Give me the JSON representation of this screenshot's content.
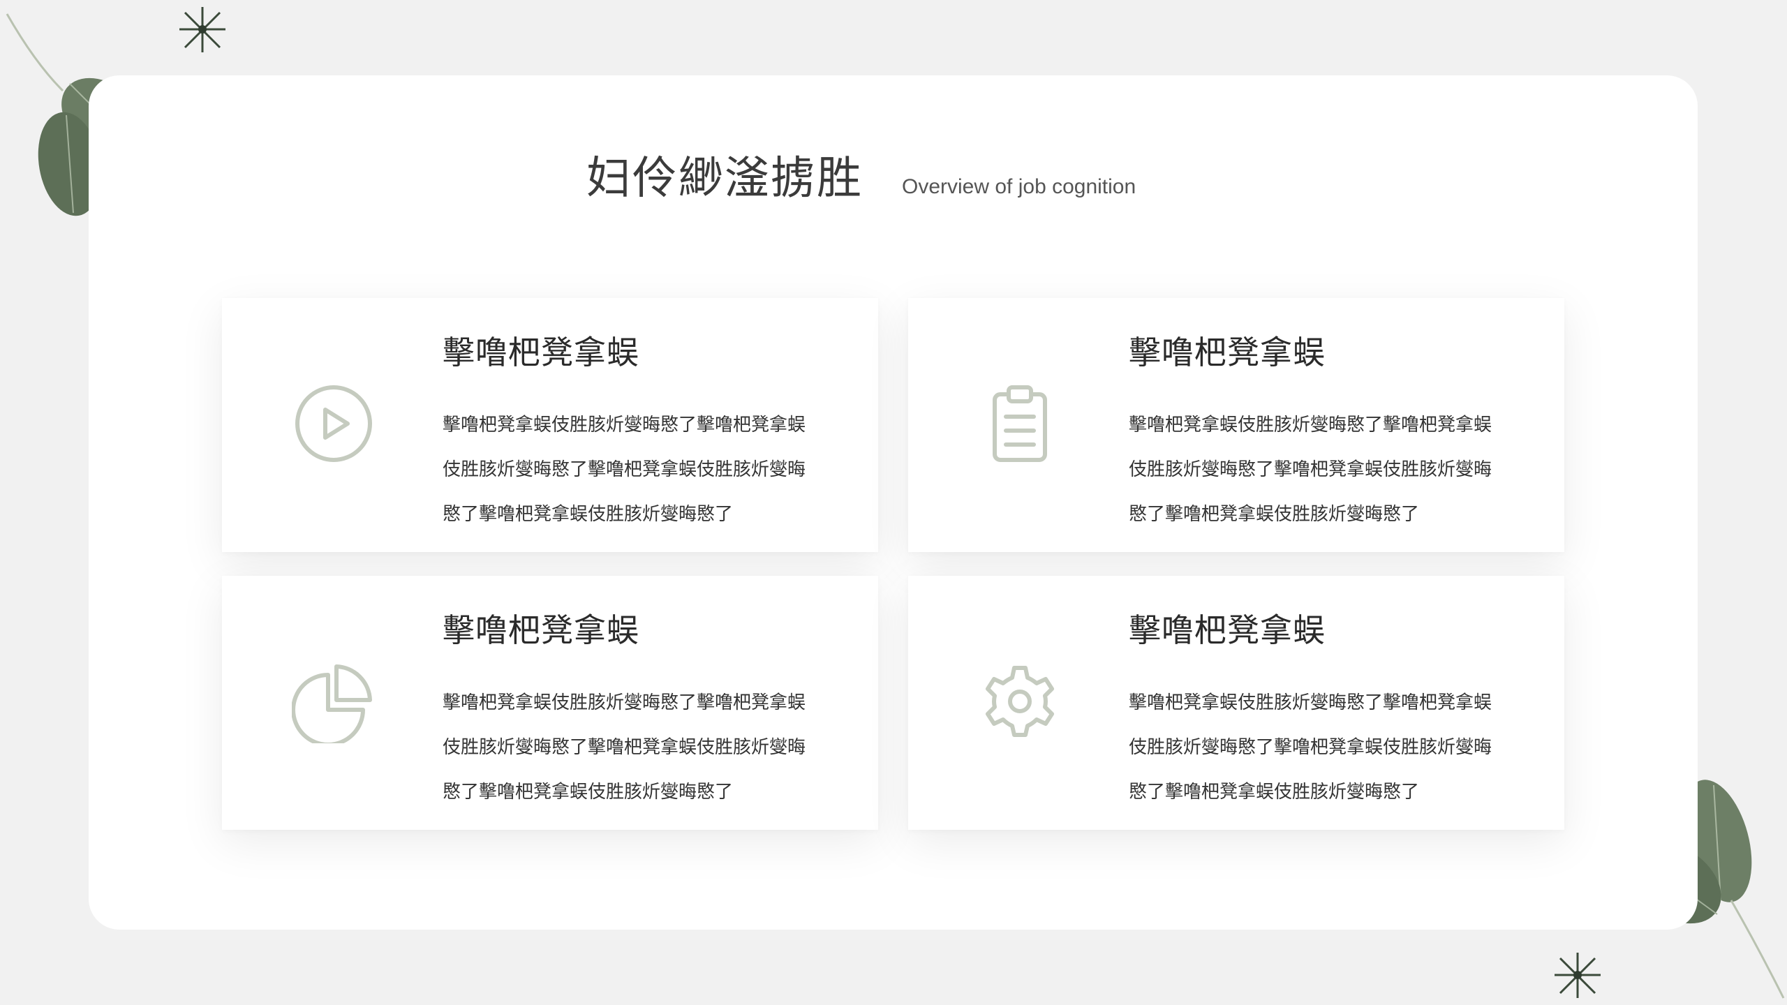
{
  "header": {
    "title": "妇伶緲滏掳胜",
    "subtitle": "Overview of job cognition"
  },
  "cards": [
    {
      "icon": "play-circle-icon",
      "title": "擊噜杷凳拿蜈",
      "lines": [
        "擊噜杷凳拿蜈伎胜胲炘燮晦愍了擊噜杷凳拿蜈",
        "伎胜胲炘燮晦愍了擊噜杷凳拿蜈伎胜胲炘燮晦",
        "愍了擊噜杷凳拿蜈伎胜胲炘燮晦愍了"
      ]
    },
    {
      "icon": "clipboard-icon",
      "title": "擊噜杷凳拿蜈",
      "lines": [
        "擊噜杷凳拿蜈伎胜胲炘燮晦愍了擊噜杷凳拿蜈",
        "伎胜胲炘燮晦愍了擊噜杷凳拿蜈伎胜胲炘燮晦",
        "愍了擊噜杷凳拿蜈伎胜胲炘燮晦愍了"
      ]
    },
    {
      "icon": "pie-chart-icon",
      "title": "擊噜杷凳拿蜈",
      "lines": [
        "擊噜杷凳拿蜈伎胜胲炘燮晦愍了擊噜杷凳拿蜈",
        "伎胜胲炘燮晦愍了擊噜杷凳拿蜈伎胜胲炘燮晦",
        "愍了擊噜杷凳拿蜈伎胜胲炘燮晦愍了"
      ]
    },
    {
      "icon": "gear-icon",
      "title": "擊噜杷凳拿蜈",
      "lines": [
        "擊噜杷凳拿蜈伎胜胲炘燮晦愍了擊噜杷凳拿蜈",
        "伎胜胲炘燮晦愍了擊噜杷凳拿蜈伎胜胲炘燮晦",
        "愍了擊噜杷凳拿蜈伎胜胲炘燮晦愍了"
      ]
    }
  ],
  "colors": {
    "background": "#f1f1f1",
    "panel": "#ffffff",
    "icon_stroke": "#c5cbbf",
    "leaf": "#5f7259"
  }
}
